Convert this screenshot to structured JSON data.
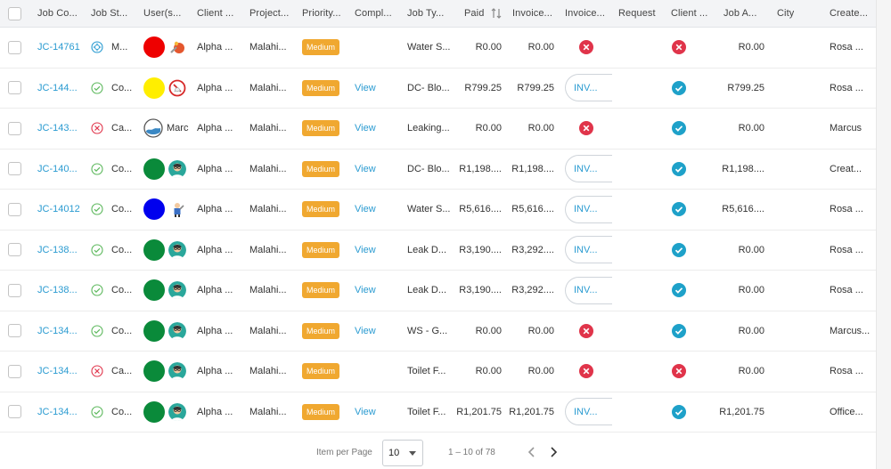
{
  "header": {
    "job_code": "Job Co...",
    "job_status": "Job St...",
    "users": "User(s...",
    "client": "Client ...",
    "project": "Project...",
    "priority": "Priority...",
    "completion": "Compl...",
    "job_type": "Job Ty...",
    "paid": "Paid",
    "invoiced": "Invoice...",
    "invoice_status": "Invoice...",
    "request": "Request",
    "client_approved": "Client ...",
    "job_amount": "Job A...",
    "city": "City",
    "created": "Create..."
  },
  "rows": [
    {
      "code": "JC-14761",
      "status_icon": "maintenance-icon",
      "status": "M...",
      "user_color": "#ee0000",
      "avatar": "wrench-avatar",
      "user_name": "",
      "client": "Alpha ...",
      "project": "Malahi...",
      "priority": "Medium",
      "completion": "",
      "job_type": "Water S...",
      "paid": "R0.00",
      "invoiced": "R0.00",
      "invoice_kind": "x",
      "invoice_label": "",
      "client_ok": "x",
      "job_amount": "R0.00",
      "city": "",
      "created": "Rosa ..."
    },
    {
      "code": "JC-144...",
      "status_icon": "check-circle-icon",
      "status": "Co...",
      "user_color": "#ffee00",
      "avatar": "ghost-avatar",
      "user_name": "",
      "client": "Alpha ...",
      "project": "Malahi...",
      "priority": "Medium",
      "completion": "View",
      "job_type": "DC- Blo...",
      "paid": "R799.25",
      "invoiced": "R799.25",
      "invoice_kind": "btn",
      "invoice_label": "INV...",
      "client_ok": "check",
      "job_amount": "R799.25",
      "city": "",
      "created": "Rosa ..."
    },
    {
      "code": "JC-143...",
      "status_icon": "x-circle-icon",
      "status": "Ca...",
      "user_color": "",
      "avatar": "wave-avatar",
      "user_name": "Marc",
      "client": "Alpha ...",
      "project": "Malahi...",
      "priority": "Medium",
      "completion": "View",
      "job_type": "Leaking...",
      "paid": "R0.00",
      "invoiced": "R0.00",
      "invoice_kind": "x",
      "invoice_label": "",
      "client_ok": "check",
      "job_amount": "R0.00",
      "city": "",
      "created": "Marcus"
    },
    {
      "code": "JC-140...",
      "status_icon": "check-circle-icon",
      "status": "Co...",
      "user_color": "#0a8a3a",
      "avatar": "person-avatar",
      "user_name": "",
      "client": "Alpha ...",
      "project": "Malahi...",
      "priority": "Medium",
      "completion": "View",
      "job_type": "DC- Blo...",
      "paid": "R1,198....",
      "invoiced": "R1,198....",
      "invoice_kind": "btn",
      "invoice_label": "INV...",
      "client_ok": "check",
      "job_amount": "R1,198....",
      "city": "",
      "created": "Creat..."
    },
    {
      "code": "JC-14012",
      "status_icon": "check-circle-icon",
      "status": "Co...",
      "user_color": "#0000ee",
      "avatar": "plumber-avatar",
      "user_name": "",
      "client": "Alpha ...",
      "project": "Malahi...",
      "priority": "Medium",
      "completion": "View",
      "job_type": "Water S...",
      "paid": "R5,616....",
      "invoiced": "R5,616....",
      "invoice_kind": "btn",
      "invoice_label": "INV...",
      "client_ok": "check",
      "job_amount": "R5,616....",
      "city": "",
      "created": "Rosa ..."
    },
    {
      "code": "JC-138...",
      "status_icon": "check-circle-icon",
      "status": "Co...",
      "user_color": "#0a8a3a",
      "avatar": "person-avatar",
      "user_name": "",
      "client": "Alpha ...",
      "project": "Malahi...",
      "priority": "Medium",
      "completion": "View",
      "job_type": "Leak D...",
      "paid": "R3,190....",
      "invoiced": "R3,292....",
      "invoice_kind": "btn",
      "invoice_label": "INV...",
      "client_ok": "check",
      "job_amount": "R0.00",
      "city": "",
      "created": "Rosa ..."
    },
    {
      "code": "JC-138...",
      "status_icon": "check-circle-icon",
      "status": "Co...",
      "user_color": "#0a8a3a",
      "avatar": "person-avatar",
      "user_name": "",
      "client": "Alpha ...",
      "project": "Malahi...",
      "priority": "Medium",
      "completion": "View",
      "job_type": "Leak D...",
      "paid": "R3,190....",
      "invoiced": "R3,292....",
      "invoice_kind": "btn",
      "invoice_label": "INV...",
      "client_ok": "check",
      "job_amount": "R0.00",
      "city": "",
      "created": "Rosa ..."
    },
    {
      "code": "JC-134...",
      "status_icon": "check-circle-icon",
      "status": "Co...",
      "user_color": "#0a8a3a",
      "avatar": "person-avatar",
      "user_name": "",
      "client": "Alpha ...",
      "project": "Malahi...",
      "priority": "Medium",
      "completion": "View",
      "job_type": "WS - G...",
      "paid": "R0.00",
      "invoiced": "R0.00",
      "invoice_kind": "x",
      "invoice_label": "",
      "client_ok": "check",
      "job_amount": "R0.00",
      "city": "",
      "created": "Marcus..."
    },
    {
      "code": "JC-134...",
      "status_icon": "x-circle-icon",
      "status": "Ca...",
      "user_color": "#0a8a3a",
      "avatar": "person-avatar",
      "user_name": "",
      "client": "Alpha ...",
      "project": "Malahi...",
      "priority": "Medium",
      "completion": "",
      "job_type": "Toilet F...",
      "paid": "R0.00",
      "invoiced": "R0.00",
      "invoice_kind": "x",
      "invoice_label": "",
      "client_ok": "x",
      "job_amount": "R0.00",
      "city": "",
      "created": "Rosa ..."
    },
    {
      "code": "JC-134...",
      "status_icon": "check-circle-icon",
      "status": "Co...",
      "user_color": "#0a8a3a",
      "avatar": "person-avatar",
      "user_name": "",
      "client": "Alpha ...",
      "project": "Malahi...",
      "priority": "Medium",
      "completion": "View",
      "job_type": "Toilet F...",
      "paid": "R1,201.75",
      "invoiced": "R1,201.75",
      "invoice_kind": "btn",
      "invoice_label": "INV...",
      "client_ok": "check",
      "job_amount": "R1,201.75",
      "city": "",
      "created": "Office..."
    }
  ],
  "footer": {
    "items_per_page_label": "Item per Page",
    "items_per_page_value": "10",
    "range": "1 – 10 of 78",
    "prev_icon": "chevron-left-icon",
    "next_icon": "chevron-right-icon"
  },
  "colors": {
    "link": "#2a9bd1",
    "badge": "#f0a830",
    "x_red": "#e0344a",
    "check_teal": "#1ea1c9",
    "status_green": "#5cb85c"
  }
}
